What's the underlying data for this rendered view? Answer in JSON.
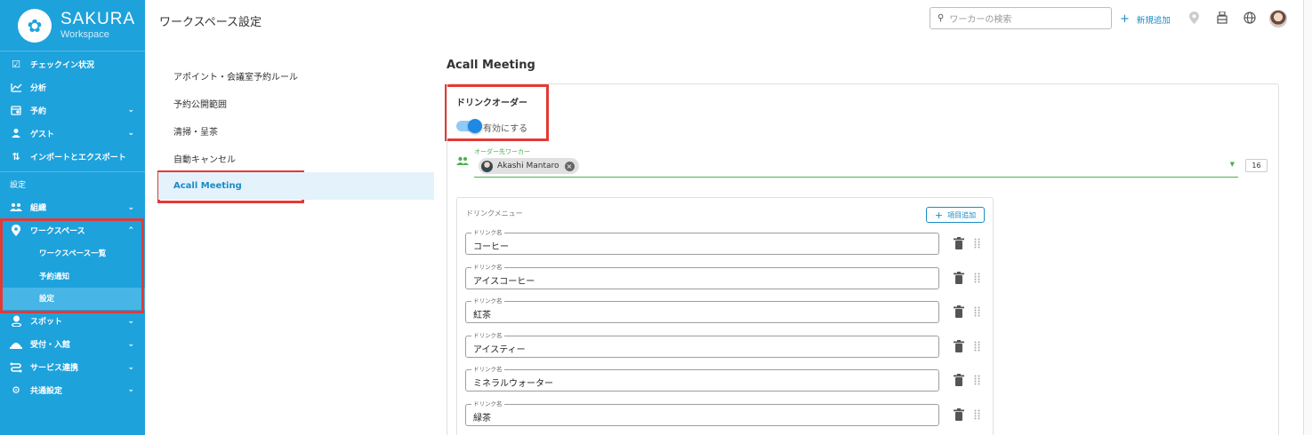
{
  "sidebar": {
    "brand_title": "SAKURA",
    "brand_sub": "Workspace",
    "items": [
      {
        "label": "チェックイン状況",
        "icon": "checkbox-icon"
      },
      {
        "label": "分析",
        "icon": "chart-icon"
      },
      {
        "label": "予約",
        "icon": "calendar-icon"
      },
      {
        "label": "ゲスト",
        "icon": "guest-icon"
      },
      {
        "label": "インポートとエクスポート",
        "icon": "import-export-icon"
      }
    ],
    "section_label": "設定",
    "settings_items": [
      {
        "label": "組織",
        "icon": "people-icon"
      },
      {
        "label": "ワークスペース",
        "icon": "location-pin-icon"
      }
    ],
    "workspace_sub": [
      "ワークスペース一覧",
      "予約通知",
      "設定"
    ],
    "more_items": [
      {
        "label": "スポット",
        "icon": "spot-icon"
      },
      {
        "label": "受付・入館",
        "icon": "reception-icon"
      },
      {
        "label": "サービス連携",
        "icon": "integration-icon"
      },
      {
        "label": "共通設定",
        "icon": "settings-icon"
      }
    ]
  },
  "header": {
    "title": "ワークスペース設定",
    "search_placeholder": "ワーカーの検索",
    "add_new": "新規追加"
  },
  "settings_menu": [
    "アポイント・会議室予約ルール",
    "予約公開範囲",
    "清掃・呈茶",
    "自動キャンセル",
    "Acall Meeting"
  ],
  "content": {
    "section_title": "Acall Meeting",
    "drink_order_heading": "ドリンクオーダー",
    "toggle_label": "有効にする",
    "toggle_on": true,
    "order_worker_label": "オーダー先ワーカー",
    "order_worker_chip": "Akashi Mantaro",
    "count": "16",
    "drink_menu_title": "ドリンクメニュー",
    "add_item_label": "項目追加",
    "drink_field_label": "ドリンク名",
    "drinks": [
      "コーヒー",
      "アイスコーヒー",
      "紅茶",
      "アイスティー",
      "ミネラルウォーター",
      "緑茶"
    ]
  },
  "colors": {
    "sidebar_bg": "#1ea2dc",
    "accent": "#1a8cc7",
    "highlight_box": "#e53935",
    "success_green": "#4caf50"
  }
}
